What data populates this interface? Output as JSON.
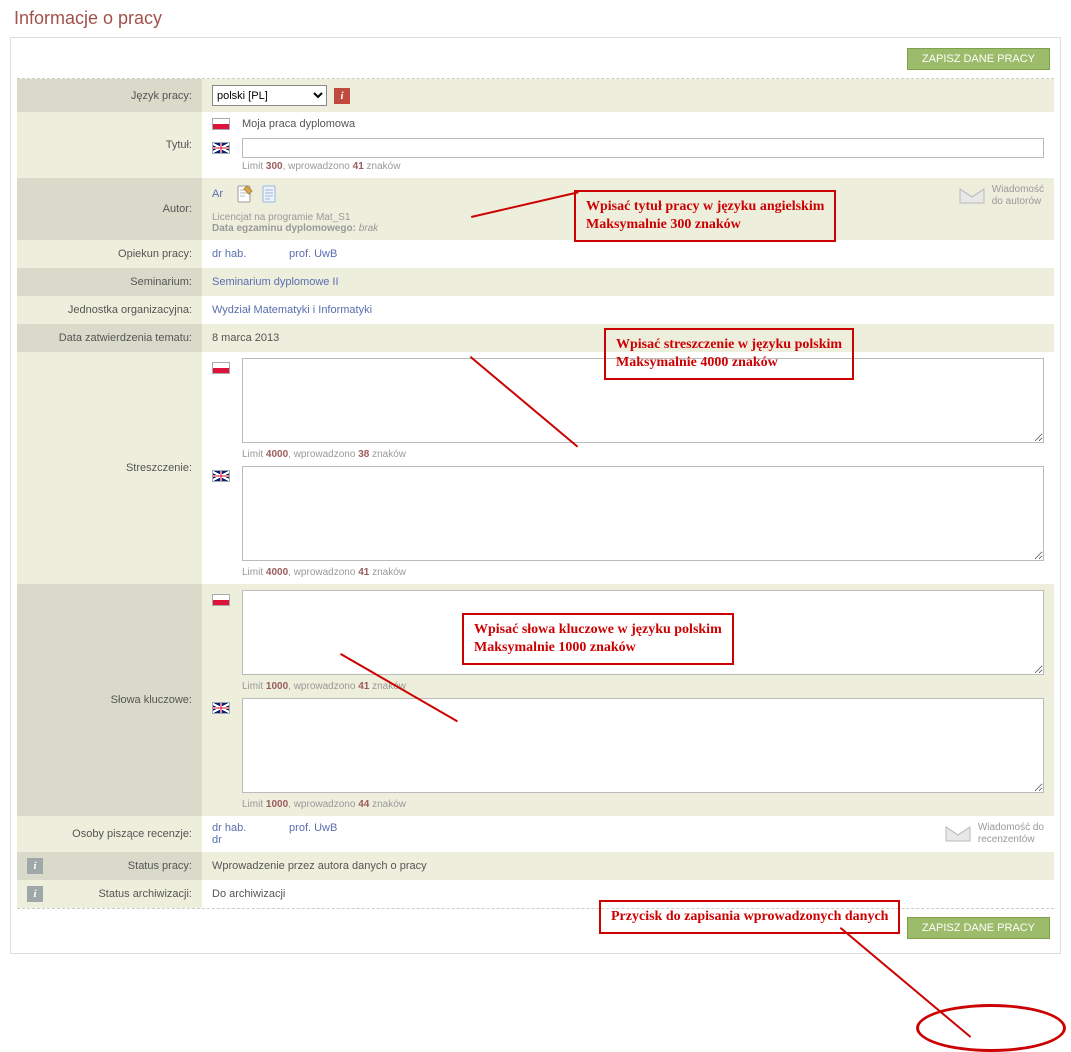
{
  "page_title": "Informacje o pracy",
  "save_button": "ZAPISZ DANE PRACY",
  "labels": {
    "language": "Język pracy:",
    "title": "Tytuł:",
    "author": "Autor:",
    "supervisor": "Opiekun pracy:",
    "seminar": "Seminarium:",
    "org_unit": "Jednostka organizacyjna:",
    "approve_date": "Data zatwierdzenia tematu:",
    "abstract": "Streszczenie:",
    "keywords": "Słowa kluczowe:",
    "reviewers": "Osoby piszące recenzje:",
    "status": "Status pracy:",
    "archive_status": "Status archiwizacji:"
  },
  "language_select": {
    "selected": "polski [PL]"
  },
  "title_section": {
    "pl_value": "Moja praca dyplomowa",
    "en_value": "",
    "limit_text_prefix": "Limit ",
    "limit_value": "300",
    "entered_prefix": ", wprowadzono ",
    "entered_value": "41",
    "entered_suffix": " znaków"
  },
  "author_section": {
    "name_prefix": "Ar",
    "program_line": "Licencjat na programie Mat_S1",
    "exam_label": "Data egzaminu dyplomowego:",
    "exam_value": "brak",
    "msg_label_line1": "Wiadomość",
    "msg_label_line2": "do autorów"
  },
  "supervisor_section": {
    "prefix": "dr hab.",
    "suffix": "prof. UwB"
  },
  "seminar_value": "Seminarium dyplomowe II",
  "org_unit_value": "Wydział Matematyki i Informatyki",
  "approve_date_value": "8 marca 2013",
  "abstract_section": {
    "pl": {
      "limit": "4000",
      "entered": "38"
    },
    "en": {
      "limit": "4000",
      "entered": "41"
    }
  },
  "keywords_section": {
    "pl": {
      "limit": "1000",
      "entered": "41"
    },
    "en": {
      "limit": "1000",
      "entered": "44"
    }
  },
  "reviewers_section": {
    "line1_prefix": "dr hab.",
    "line1_suffix": "prof. UwB",
    "line2": "dr",
    "msg_label_line1": "Wiadomość do",
    "msg_label_line2": "recenzentów"
  },
  "status_value": "Wprowadzenie przez autora danych o pracy",
  "archive_value": "Do archiwizacji",
  "annotations": {
    "a1": "Wpisać tytuł pracy w języku angielskim\nMaksymalnie 300 znaków",
    "a2": "Wpisać streszczenie w języku polskim\nMaksymalnie 4000 znaków",
    "a3": "Wpisać słowa kluczowe w języku polskim\nMaksymalnie 1000 znaków",
    "a4": "Przycisk do zapisania wprowadzonych danych"
  },
  "limit_words": {
    "prefix": "Limit ",
    "middle": ", wprowadzono ",
    "suffix": " znaków"
  }
}
